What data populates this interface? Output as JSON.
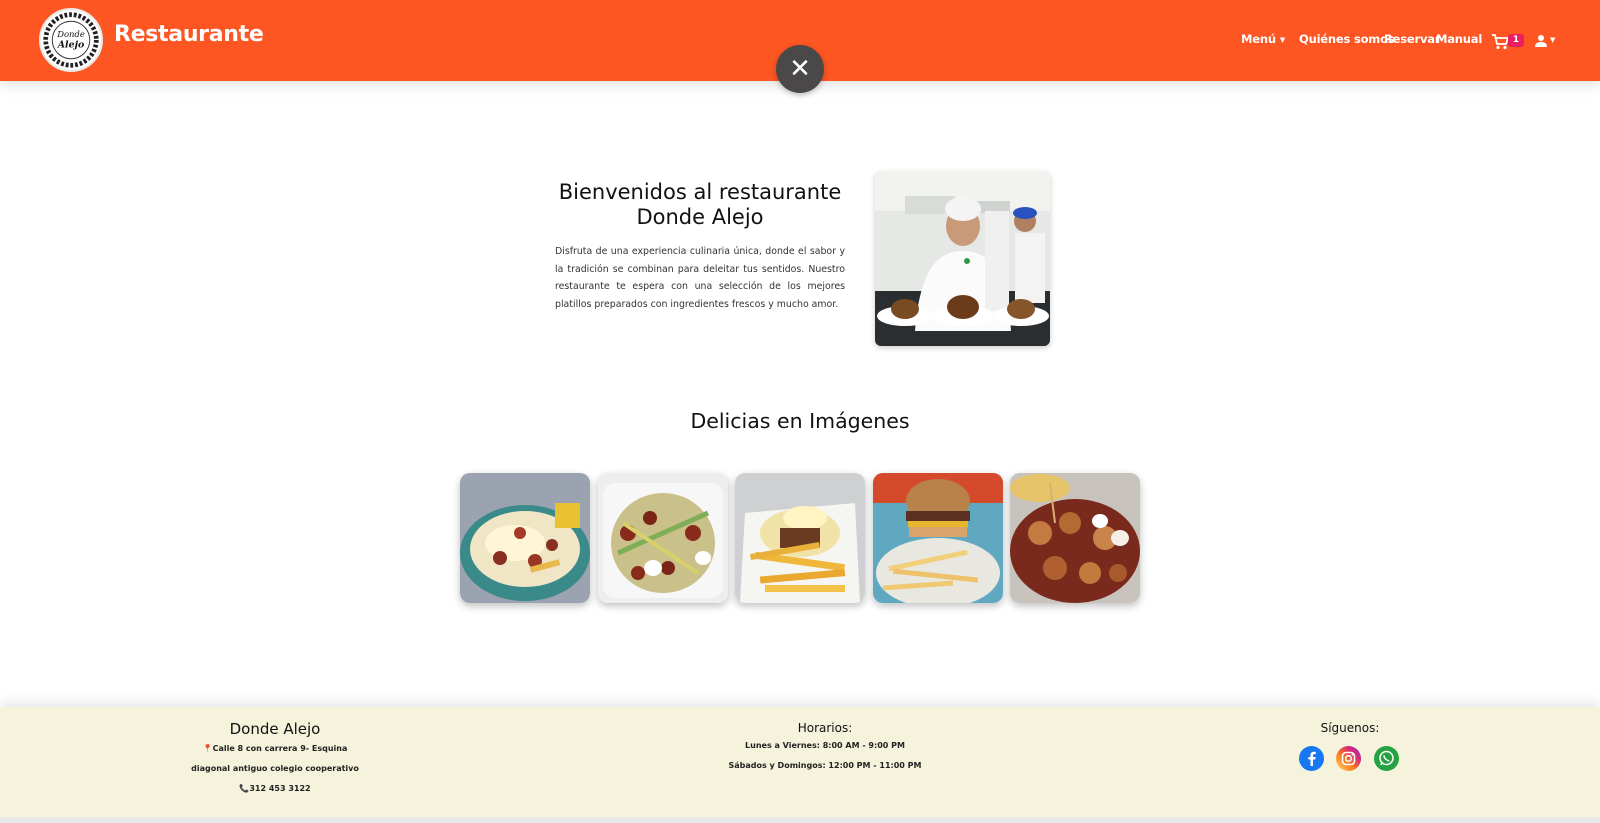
{
  "navbar": {
    "brand": "Restaurante",
    "logo_text": "Donde Alejo",
    "links": [
      "Menú",
      "Quiénes somos",
      "Reservar",
      "Manual"
    ],
    "cart_count": "1",
    "accent_color": "#fd5623"
  },
  "hero": {
    "title": "Bienvenidos al restaurante Donde Alejo",
    "text": "Disfruta de una experiencia culinaria única, donde el sabor y la tradición se combinan para deleitar tus sentidos. Nuestro restaurante te espera con una selección de los mejores platillos preparados con ingredientes frescos y mucho amor."
  },
  "gallery": {
    "title": "Delicias en Imágenes"
  },
  "footer": {
    "name": "Donde Alejo",
    "address_line1": "Calle 8 con carrera 9- Esquina",
    "address_line2": "diagonal antiguo colegio cooperativo",
    "phone": "312 453 3122",
    "hours_title": "Horarios:",
    "hours_weekdays": "Lunes a Viernes: 8:00 AM - 9:00 PM",
    "hours_weekend": "Sábados y Domingos: 12:00 PM - 11:00 PM",
    "social_title": "Síguenos:",
    "background_color": "#f5f3dc"
  },
  "icons": [
    "close-icon",
    "cart-icon",
    "user-icon",
    "pin-icon",
    "phone-icon",
    "facebook-icon",
    "instagram-icon",
    "whatsapp-icon"
  ]
}
